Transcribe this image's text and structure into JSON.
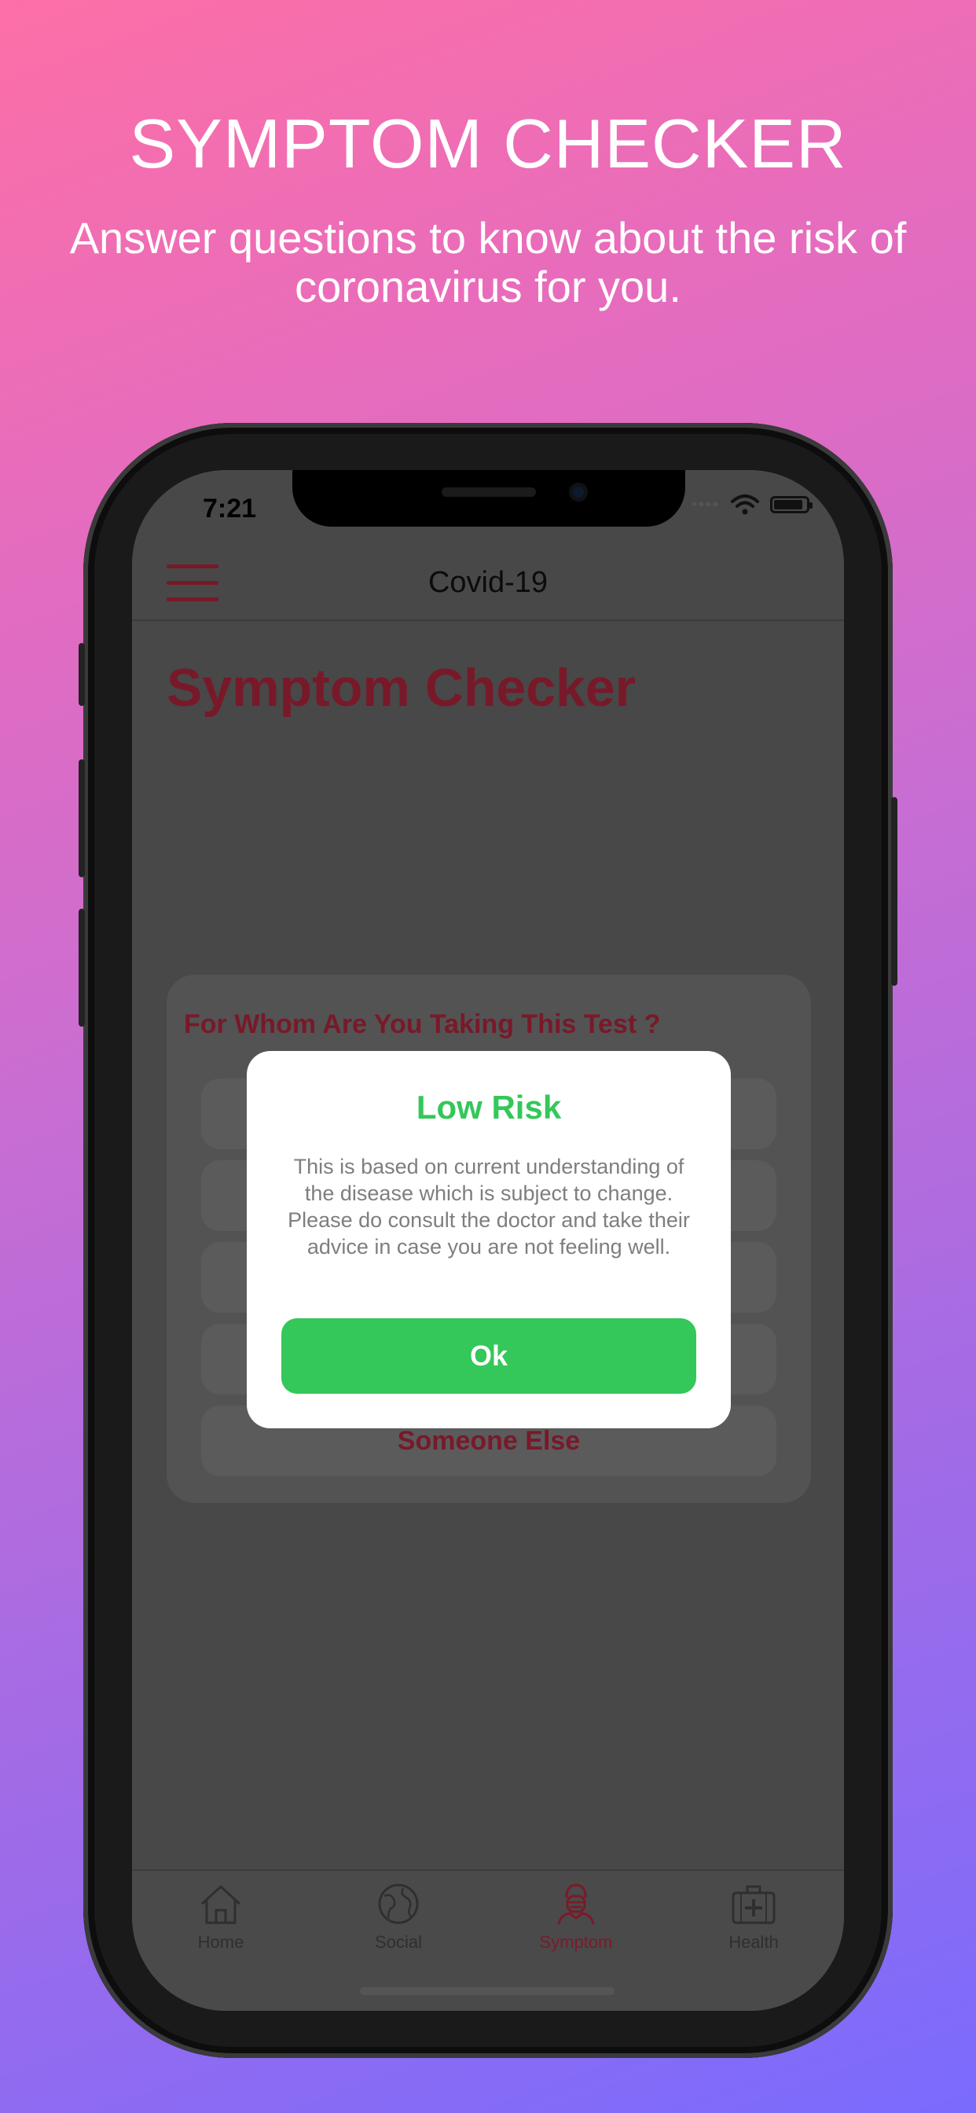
{
  "promo": {
    "headline": "SYMPTOM CHECKER",
    "subline": "Answer questions to know about the risk of coronavirus for you."
  },
  "status_bar": {
    "time": "7:21"
  },
  "app_bar": {
    "title": "Covid-19"
  },
  "page": {
    "title": "Symptom Checker"
  },
  "question_card": {
    "question": "For Whom Are You Taking This Test ?",
    "options": [
      "",
      "",
      "",
      "",
      "Someone Else"
    ]
  },
  "dialog": {
    "title": "Low Risk",
    "body": "This is based on current understanding of the disease which is subject to change. Please do consult the doctor and take their advice in case you are not feeling well.",
    "ok_label": "Ok"
  },
  "tab_bar": {
    "items": [
      {
        "label": "Home",
        "icon": "home-icon",
        "active": false
      },
      {
        "label": "Social",
        "icon": "globe-icon",
        "active": false
      },
      {
        "label": "Symptom",
        "icon": "masked-person-icon",
        "active": true
      },
      {
        "label": "Health",
        "icon": "first-aid-kit-icon",
        "active": false
      }
    ]
  },
  "colors": {
    "accent": "#7b1a2a",
    "success": "#34c759",
    "gradient_top": "#fd6fa6",
    "gradient_bottom": "#7a6bfd"
  }
}
